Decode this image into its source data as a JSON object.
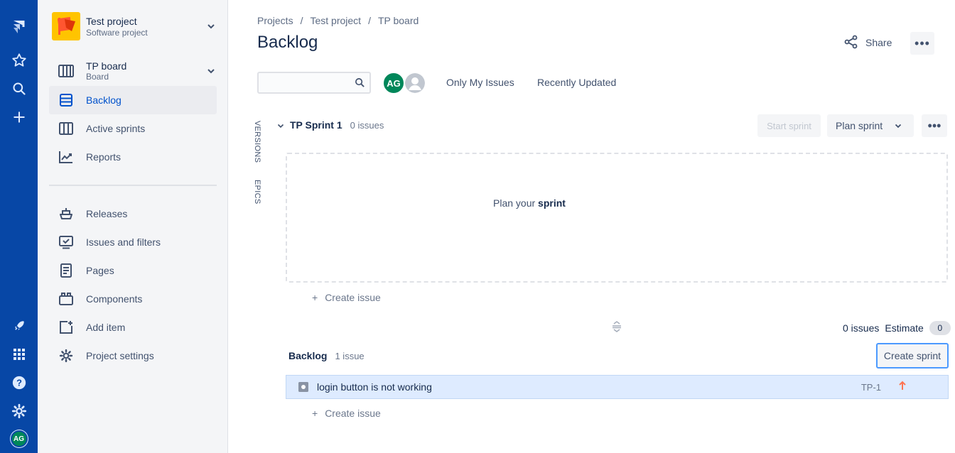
{
  "rail": {
    "avatar_initials": "AG"
  },
  "sidebar": {
    "project": {
      "name": "Test project",
      "type": "Software project"
    },
    "board": {
      "name": "TP board",
      "type": "Board"
    },
    "items": [
      {
        "label": "Backlog",
        "icon": "backlog-icon"
      },
      {
        "label": "Active sprints",
        "icon": "active-sprints-icon"
      },
      {
        "label": "Reports",
        "icon": "reports-icon"
      }
    ],
    "items2": [
      {
        "label": "Releases",
        "icon": "releases-icon"
      },
      {
        "label": "Issues and filters",
        "icon": "issues-filters-icon"
      },
      {
        "label": "Pages",
        "icon": "pages-icon"
      },
      {
        "label": "Components",
        "icon": "components-icon"
      },
      {
        "label": "Add item",
        "icon": "add-item-icon"
      },
      {
        "label": "Project settings",
        "icon": "gear-icon"
      }
    ]
  },
  "header": {
    "breadcrumbs": [
      "Projects",
      "Test project",
      "TP board"
    ],
    "title": "Backlog",
    "share_label": "Share",
    "more_label": "•••"
  },
  "filters": {
    "search_value": "",
    "avatar_initials": "AG",
    "only_my_issues": "Only My Issues",
    "recently_updated": "Recently Updated"
  },
  "side_tabs": {
    "versions": "VERSIONS",
    "epics": "EPICS"
  },
  "sprint": {
    "name": "TP Sprint 1",
    "count": "0 issues",
    "start_label": "Start sprint",
    "plan_label": "Plan sprint",
    "more_label": "•••",
    "empty_msg_pre": "Plan your ",
    "empty_msg_bold": "sprint",
    "create_issue": "Create issue"
  },
  "summary": {
    "issues": "0 issues",
    "estimate_label": "Estimate",
    "estimate_value": "0"
  },
  "backlog": {
    "name": "Backlog",
    "count": "1 issue",
    "create_sprint": "Create sprint",
    "issues": [
      {
        "summary": "login button is not working",
        "key": "TP-1",
        "priority": "high"
      }
    ],
    "create_issue": "Create issue"
  },
  "colors": {
    "rail": "#0747A6",
    "accent": "#0052CC",
    "avatar": "#00875A",
    "selected_row": "#DEEBFF",
    "priority_high": "#FF7452"
  }
}
